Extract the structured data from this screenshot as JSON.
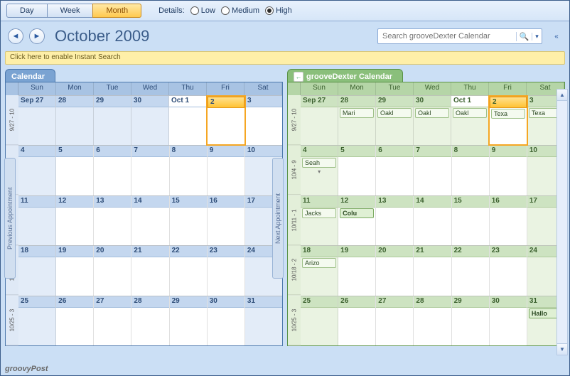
{
  "toolbar": {
    "views": [
      "Day",
      "Week",
      "Month"
    ],
    "active_view": "Month",
    "details_label": "Details:",
    "details_options": [
      "Low",
      "Medium",
      "High"
    ],
    "details_selected": "High"
  },
  "header": {
    "title": "October 2009",
    "search_placeholder": "Search grooveDexter Calendar"
  },
  "instant_search": "Click here to enable Instant Search",
  "day_names": [
    "Sun",
    "Mon",
    "Tue",
    "Wed",
    "Thu",
    "Fri",
    "Sat"
  ],
  "week_labels": [
    "9/27 - 10",
    "10/4 - 9",
    "10/11 - 1",
    "10/18 - 2",
    "10/25 - 3"
  ],
  "calendars": [
    {
      "name": "Calendar",
      "theme": "blue",
      "weeks": [
        [
          {
            "d": "Sep 27",
            "shade": true
          },
          {
            "d": "28",
            "shade": true
          },
          {
            "d": "29",
            "shade": true
          },
          {
            "d": "30",
            "shade": true
          },
          {
            "d": "Oct 1",
            "oct1": true
          },
          {
            "d": "2",
            "today": true
          },
          {
            "d": "3"
          }
        ],
        [
          {
            "d": "4",
            "shade": true
          },
          {
            "d": "5"
          },
          {
            "d": "6"
          },
          {
            "d": "7"
          },
          {
            "d": "8"
          },
          {
            "d": "9"
          },
          {
            "d": "10",
            "shade": true
          }
        ],
        [
          {
            "d": "11",
            "shade": true
          },
          {
            "d": "12"
          },
          {
            "d": "13"
          },
          {
            "d": "14"
          },
          {
            "d": "15"
          },
          {
            "d": "16"
          },
          {
            "d": "17",
            "shade": true
          }
        ],
        [
          {
            "d": "18",
            "shade": true
          },
          {
            "d": "19"
          },
          {
            "d": "20"
          },
          {
            "d": "21"
          },
          {
            "d": "22"
          },
          {
            "d": "23"
          },
          {
            "d": "24",
            "shade": true
          }
        ],
        [
          {
            "d": "25",
            "shade": true
          },
          {
            "d": "26"
          },
          {
            "d": "27"
          },
          {
            "d": "28"
          },
          {
            "d": "29"
          },
          {
            "d": "30"
          },
          {
            "d": "31",
            "shade": true
          }
        ]
      ]
    },
    {
      "name": "grooveDexter Calendar",
      "theme": "green",
      "weeks": [
        [
          {
            "d": "Sep 27",
            "shade": true
          },
          {
            "d": "28",
            "shade": true,
            "events": [
              {
                "t": "Mari"
              }
            ]
          },
          {
            "d": "29",
            "shade": true,
            "events": [
              {
                "t": "Oakl"
              }
            ]
          },
          {
            "d": "30",
            "shade": true,
            "events": [
              {
                "t": "Oakl"
              }
            ]
          },
          {
            "d": "Oct 1",
            "oct1": true,
            "shade": true,
            "events": [
              {
                "t": "Oakl"
              }
            ]
          },
          {
            "d": "2",
            "today": true,
            "events": [
              {
                "t": "Texa"
              }
            ]
          },
          {
            "d": "3",
            "shade": true,
            "events": [
              {
                "t": "Texa"
              }
            ]
          }
        ],
        [
          {
            "d": "4",
            "shade": true,
            "events": [
              {
                "t": "Seah"
              }
            ],
            "more": true
          },
          {
            "d": "5"
          },
          {
            "d": "6"
          },
          {
            "d": "7"
          },
          {
            "d": "8"
          },
          {
            "d": "9"
          },
          {
            "d": "10",
            "shade": true
          }
        ],
        [
          {
            "d": "11",
            "shade": true,
            "events": [
              {
                "t": "Jacks"
              }
            ]
          },
          {
            "d": "12",
            "events": [
              {
                "t": "Colu",
                "hl": true
              }
            ]
          },
          {
            "d": "13"
          },
          {
            "d": "14"
          },
          {
            "d": "15"
          },
          {
            "d": "16"
          },
          {
            "d": "17",
            "shade": true
          }
        ],
        [
          {
            "d": "18",
            "shade": true,
            "events": [
              {
                "t": "Arizo"
              }
            ]
          },
          {
            "d": "19"
          },
          {
            "d": "20"
          },
          {
            "d": "21"
          },
          {
            "d": "22"
          },
          {
            "d": "23"
          },
          {
            "d": "24",
            "shade": true
          }
        ],
        [
          {
            "d": "25",
            "shade": true
          },
          {
            "d": "26"
          },
          {
            "d": "27"
          },
          {
            "d": "28"
          },
          {
            "d": "29"
          },
          {
            "d": "30"
          },
          {
            "d": "31",
            "shade": true,
            "events": [
              {
                "t": "Hallo",
                "hl": true
              }
            ]
          }
        ]
      ]
    }
  ],
  "handles": {
    "prev": "Previous Appointment",
    "next": "Next Appointment"
  },
  "brand": "groovyPost"
}
